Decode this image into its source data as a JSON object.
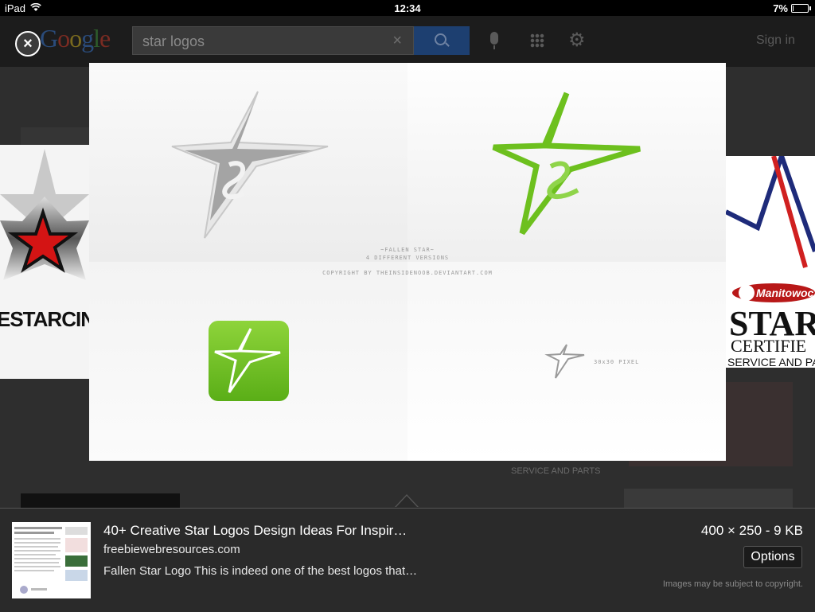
{
  "status_bar": {
    "device": "iPad",
    "time": "12:34",
    "battery": "7%",
    "battery_level": 0.07
  },
  "header": {
    "logo": [
      "G",
      "o",
      "o",
      "g",
      "l",
      "e"
    ],
    "search_value": "star logos",
    "sign_in": "Sign in"
  },
  "preview": {
    "caption_line1": "~FALLEN STAR~",
    "caption_line2": "4 DIFFERENT VERSIONS",
    "caption_line3": "COPYRIGHT BY THEINSIDENOOB.DEVIANTART.COM",
    "small_label": "30x30 PIXEL",
    "accent_green": "#6dc01e",
    "gray_star": "#a4a4a4"
  },
  "side_left": {
    "text": "ESTARCIN",
    "accent": "#d41414"
  },
  "side_right": {
    "brand": "Manitowoc",
    "line1": "STAR",
    "line2": "CERTIFIE",
    "line3": "SERVICE AND PA"
  },
  "background": {
    "service_text": "SERVICE AND PARTS"
  },
  "info": {
    "title": "40+ Creative Star Logos Design Ideas For Inspir…",
    "source": "freebiewebresources.com",
    "description": "Fallen Star Logo This is indeed one of the best logos that…",
    "size": "400 × 250 - 9 KB",
    "options_label": "Options",
    "copyright": "Images may be subject to copyright."
  }
}
